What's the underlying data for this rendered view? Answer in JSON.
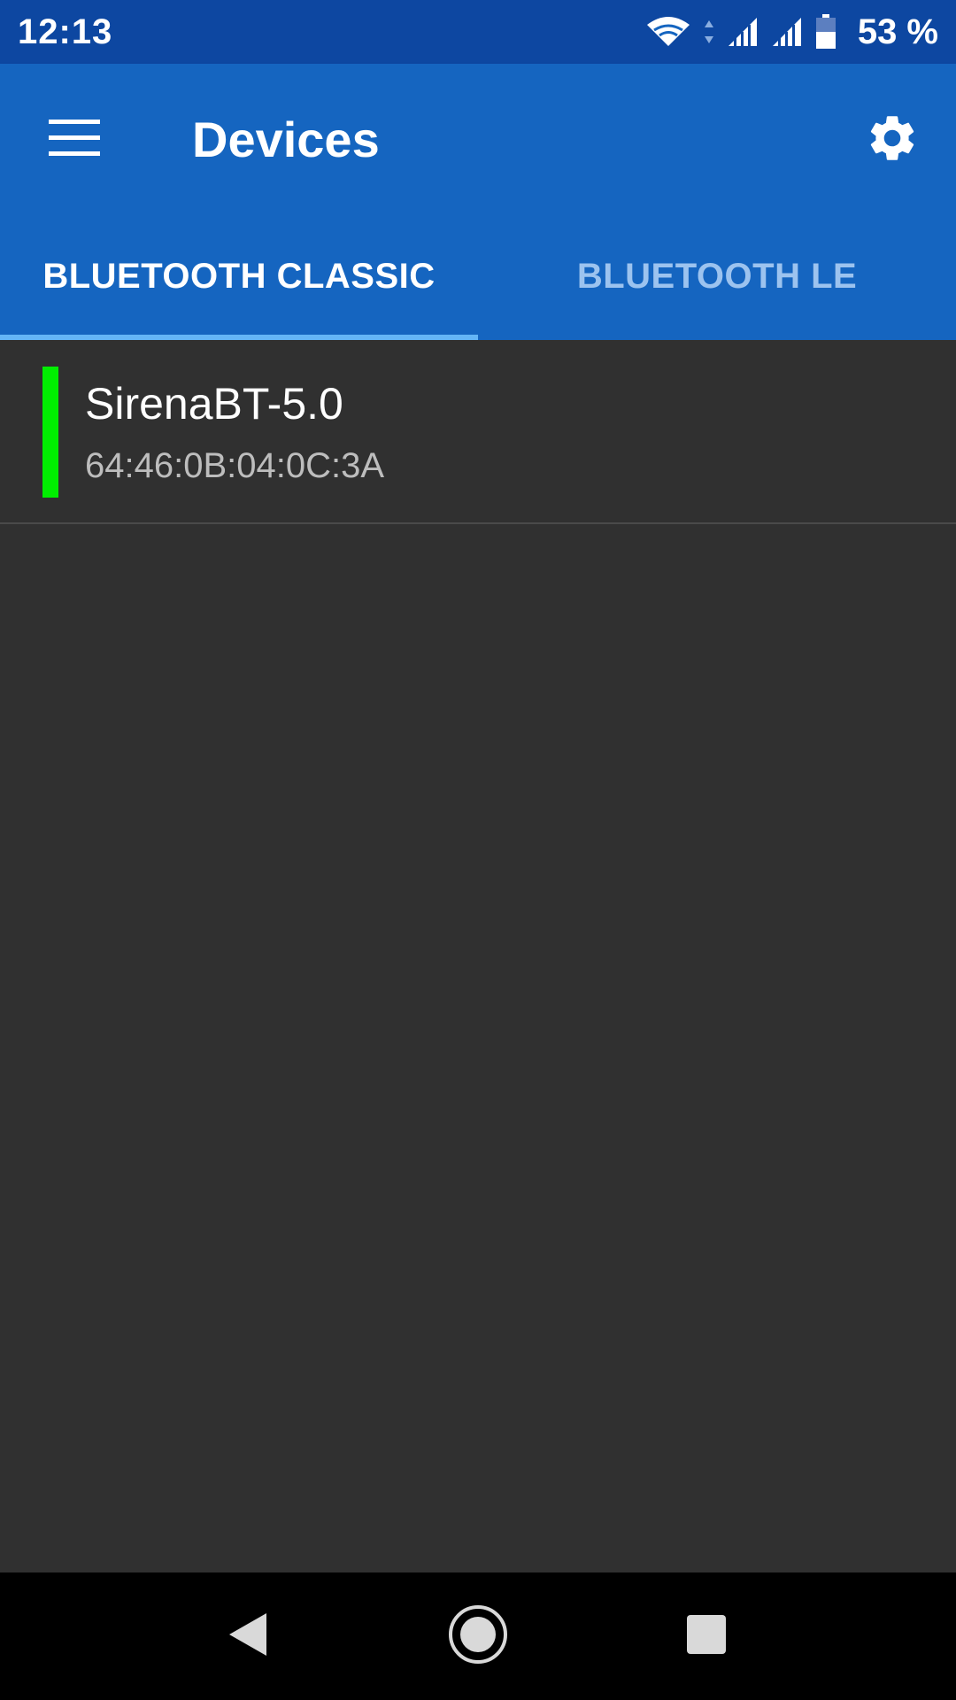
{
  "status_bar": {
    "time": "12:13",
    "battery_percent": "53 %",
    "icons": [
      "wifi-icon",
      "data-arrows-icon",
      "signal-icon",
      "signal-icon",
      "battery-icon"
    ]
  },
  "app_bar": {
    "title": "Devices",
    "menu_icon": "menu-icon",
    "settings_icon": "gear-icon"
  },
  "tabs": [
    {
      "label": "BLUETOOTH CLASSIC",
      "selected": true
    },
    {
      "label": "BLUETOOTH LE",
      "selected": false
    }
  ],
  "devices": [
    {
      "name": "SirenaBT-5.0",
      "address": "64:46:0B:04:0C:3A",
      "status_color": "#00ee00"
    }
  ],
  "navigation": {
    "icons": [
      "back-icon",
      "home-icon",
      "recents-icon"
    ]
  },
  "colors": {
    "status_bar": "#0d47a1",
    "primary": "#1565c0",
    "tab_indicator": "#64b5f6",
    "background": "#303030"
  }
}
